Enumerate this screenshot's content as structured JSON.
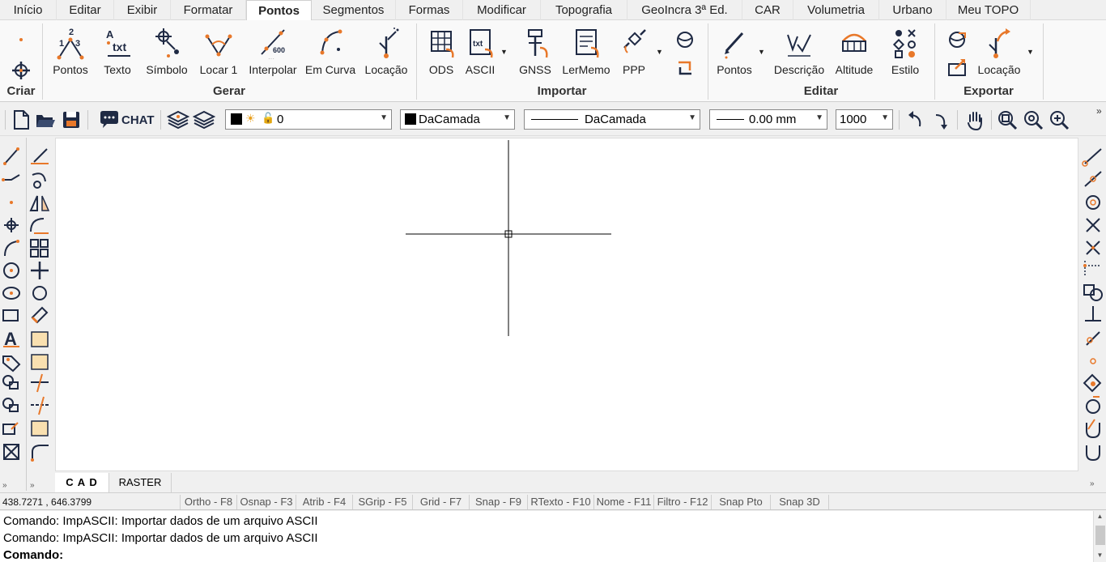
{
  "ribbon_tabs": [
    "Início",
    "Editar",
    "Exibir",
    "Formatar",
    "Pontos",
    "Segmentos",
    "Formas",
    "Modificar",
    "Topografia",
    "GeoIncra 3ª Ed.",
    "CAR",
    "Volumetria",
    "Urbano",
    "Meu TOPO"
  ],
  "active_tab": "Pontos",
  "ribbon": {
    "criar": {
      "group": "Criar"
    },
    "gerar": {
      "group": "Gerar",
      "buttons": [
        "Pontos",
        "Texto",
        "Símbolo",
        "Locar 1",
        "Interpolar",
        "Em Curva",
        "Locação"
      ]
    },
    "importar": {
      "group": "Importar",
      "buttons": [
        "ODS",
        "ASCII",
        "GNSS",
        "LerMemo",
        "PPP"
      ]
    },
    "editar": {
      "group": "Editar",
      "buttons": [
        "Pontos",
        "Descrição",
        "Altitude",
        "Estilo"
      ]
    },
    "exportar": {
      "group": "Exportar",
      "buttons": [
        "Locação"
      ]
    }
  },
  "toolbar": {
    "chat_label": "CHAT",
    "layer_value": "0",
    "color_value": "DaCamada",
    "linetype_value": "DaCamada",
    "lineweight_value": "0.00 mm",
    "scale_value": "1000"
  },
  "doc_tabs": [
    "C A D",
    "RASTER"
  ],
  "active_doc_tab": "C A D",
  "status": {
    "coords": "438.7271 , 646.3799",
    "toggles": [
      "Ortho - F8",
      "Osnap - F3",
      "Atrib - F4",
      "SGrip - F5",
      "Grid - F7",
      "Snap - F9",
      "RTexto - F10",
      "Nome - F11",
      "Filtro - F12",
      "Snap Pto",
      "Snap 3D"
    ]
  },
  "command": {
    "history": [
      "Comando: ImpASCII: Importar dados de um arquivo ASCII",
      "Comando: ImpASCII: Importar dados de um arquivo ASCII"
    ],
    "prompt": "Comando:"
  },
  "colors": {
    "accent_orange": "#e8782a",
    "icon_navy": "#1f2a44"
  }
}
